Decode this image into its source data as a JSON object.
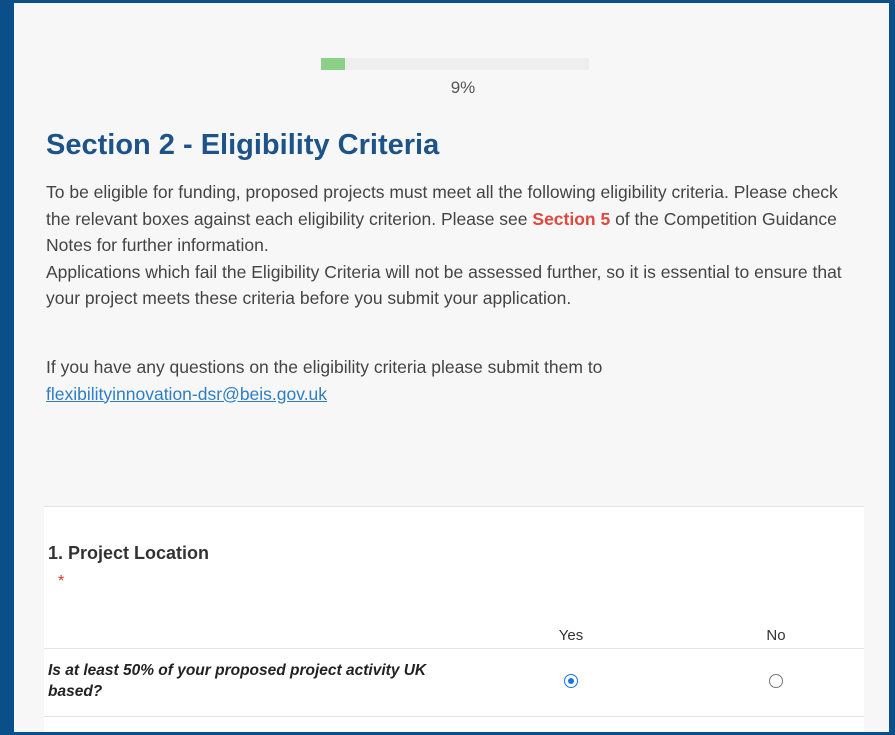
{
  "progress": {
    "value": 0.09,
    "label": "9%"
  },
  "section": {
    "title": "Section 2 - Eligibility Criteria",
    "intro_part1": "To be eligible for funding, proposed projects must meet all the following eligibility criteria. Please check the relevant boxes against each eligibility criterion. Please see ",
    "intro_highlight": "Section 5",
    "intro_part2": " of the Competition Guidance Notes for further information.",
    "intro_para2": "Applications which fail the Eligibility Criteria will not be assessed further, so it is essential to ensure that your project meets these criteria before you submit your application.",
    "contact_text": "If you have any questions on the eligibility criteria please submit them to",
    "contact_email": "flexibilityinnovation-dsr@beis.gov.uk"
  },
  "question": {
    "title": "1. Project Location",
    "required_marker": "*",
    "columns": [
      "Yes",
      "No"
    ],
    "rows": [
      {
        "label": "Is at least 50% of your proposed project activity UK based?",
        "selected": "Yes"
      }
    ]
  },
  "colors": {
    "frame": "#0a4f8a",
    "title": "#1d5388",
    "progress_fill": "#8ccf86",
    "highlight": "#e2473d",
    "link": "#2e7ec4",
    "radio_checked": "#1a73e8"
  }
}
